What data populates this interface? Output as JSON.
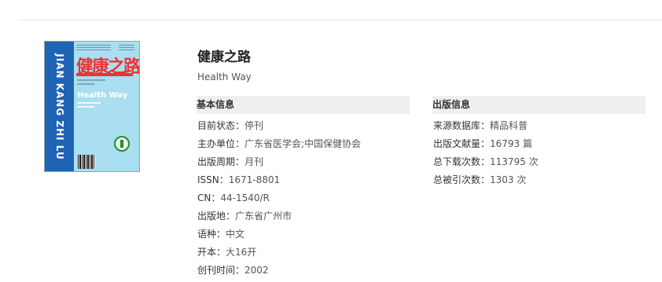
{
  "journal": {
    "title": "健康之路",
    "subtitle": "Health Way"
  },
  "cover": {
    "spine_text": "JIAN KANG ZHI LU",
    "brand_text": "健康之路",
    "english_title": "Health Way",
    "spine_color": "#1f63b4",
    "background_color": "#a9dff0",
    "accent_color": "#e33333"
  },
  "basic_info": {
    "heading": "基本信息",
    "items": [
      {
        "label": "目前状态：",
        "value": "停刊"
      },
      {
        "label": "主办单位：",
        "value": "广东省医学会;中国保健协会"
      },
      {
        "label": "出版周期：",
        "value": "月刊"
      },
      {
        "label": "ISSN：",
        "value": "1671-8801"
      },
      {
        "label": "CN：",
        "value": "44-1540/R"
      },
      {
        "label": "出版地：",
        "value": "广东省广州市"
      },
      {
        "label": "语种：",
        "value": "中文"
      },
      {
        "label": "开本：",
        "value": "大16开"
      },
      {
        "label": "创刊时间：",
        "value": "2002"
      }
    ]
  },
  "publication_info": {
    "heading": "出版信息",
    "items": [
      {
        "label": "来源数据库：",
        "value": "精品科普"
      },
      {
        "label": "出版文献量：",
        "value": "16793 篇"
      },
      {
        "label": "总下载次数：",
        "value": "113795 次"
      },
      {
        "label": "总被引次数：",
        "value": "1303 次"
      }
    ]
  }
}
